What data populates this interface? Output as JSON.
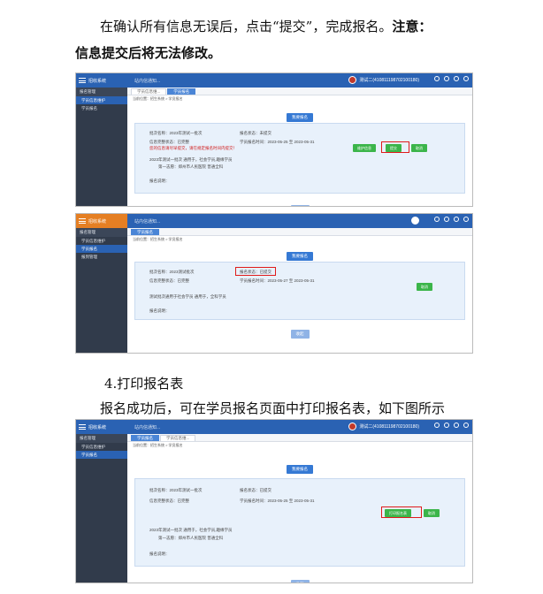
{
  "doc": {
    "p1a": "在确认所有信息无误后，点击“提交”，完成报名。",
    "p1_note": "注意：",
    "p1b": "信息提交后将无法修改。",
    "h4": "4.打印报名表",
    "p2": "报名成功后，可在学员报名页面中打印报名表，如下图所示"
  },
  "app": {
    "title": "招收系统",
    "notice": "站内信通知...",
    "user": "测试二(410811198702100180)",
    "menu_group": "报名管理",
    "menu_items": [
      "学员信息维护",
      "学员报名"
    ],
    "tab_1": "学员信息维...",
    "tab_2": "学员报名",
    "crumb": "当前位置：招生系统 > 学员报名",
    "signup_btn": "我要报名",
    "batch_name": "批次名称：2023年测试一批次",
    "status_unsubmitted": "报名状态：未提交",
    "status_submitted": "报名状态：已提交",
    "info_complete": "信息完整状态：已完整",
    "period": "学员报名时间：2023-05-25 至 2023-05-31",
    "warn": "您的信息请尽早提交，请在规定报名时间内提交！",
    "btn_maintain": "维护信息",
    "btn_submit": "提交",
    "btn_cancel": "取消",
    "btn_print": "打印报名表",
    "desc_a": "2023年测试一批次 通用于，社会学员,趣缘学员",
    "desc_b": "第一志愿：郑州市人民医院    普通全科",
    "remark": "报名说明：",
    "collapse": "收起"
  },
  "app2": {
    "menu_group": "报名管理",
    "menu_items": [
      "学员信息维护",
      "学员报名",
      "报到管理"
    ],
    "tab_1": "学员报名",
    "crumb": "当前位置：招生系统 > 学员报名",
    "signup_btn": "我要报名",
    "batch_name": "批次名称：2023测试批次",
    "status": "报名状态：已提交",
    "info_complete": "信息完整状态：已完整",
    "period": "学员报名时间：2023-05-27 至 2023-05-31",
    "btn_cancel": "取消",
    "desc_a": "测试批次通用于社会学员 通用于，全科学员",
    "remark": "报名说明：",
    "collapse": "收起"
  }
}
